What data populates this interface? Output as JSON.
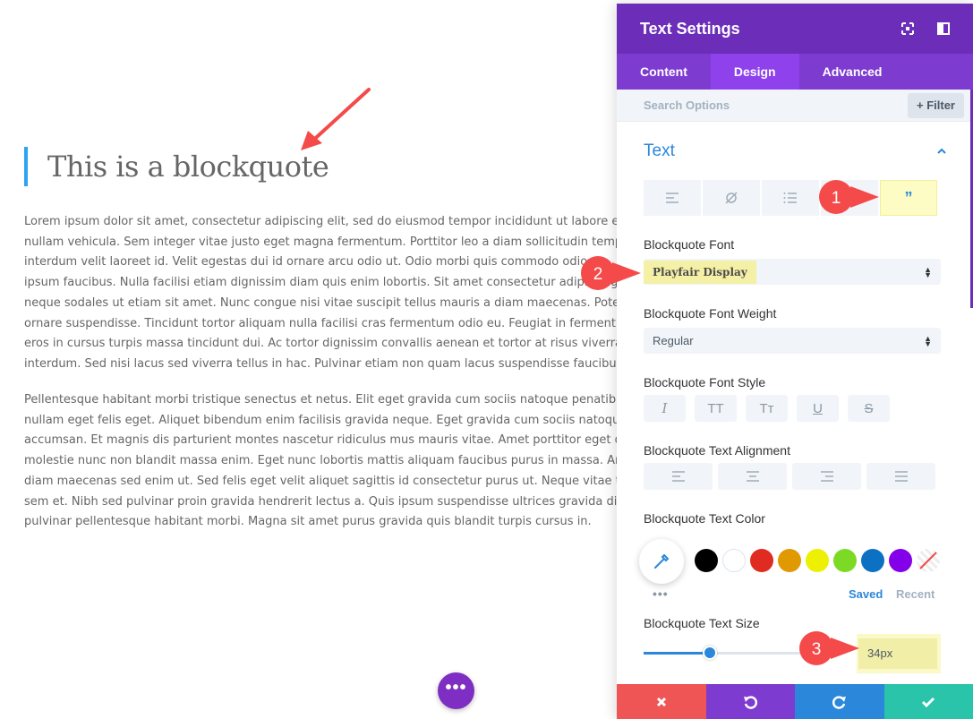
{
  "page": {
    "blockquote": "This is a blockquote",
    "paragraph1": [
      "Lorem ipsum dolor sit amet, consectetur adipiscing elit, sed do eiusmod tempor incididunt ut labore et",
      "nullam vehicula. Sem integer vitae justo eget magna fermentum. Porttitor leo a diam sollicitudin tempo",
      "interdum velit laoreet id. Velit egestas dui id ornare arcu odio ut. Odio morbi quis commodo odio",
      "ipsum faucibus. Nulla facilisi etiam dignissim diam quis enim lobortis. Sit amet consectetur adipiscing",
      "neque sodales ut etiam sit amet. Nunc congue nisi vitae suscipit tellus mauris a diam maecenas. Potenti",
      "ornare suspendisse. Tincidunt tortor aliquam nulla facilisi cras fermentum odio eu. Feugiat in fermentum",
      "eros in cursus turpis massa tincidunt dui. Ac tortor dignissim convallis aenean et tortor at risus viverra",
      "interdum. Sed nisi lacus sed viverra tellus in hac. Pulvinar etiam non quam lacus suspendisse faucibus"
    ],
    "paragraph2": [
      "Pellentesque habitant morbi tristique senectus et netus. Elit eget gravida cum sociis natoque penatibus",
      "nullam eget felis eget. Aliquet bibendum enim facilisis gravida neque. Eget gravida cum sociis natoque",
      "accumsan. Et magnis dis parturient montes nascetur ridiculus mus mauris vitae. Amet porttitor eget dolor",
      "molestie nunc non blandit massa enim. Eget nunc lobortis mattis aliquam faucibus purus in massa. Amet",
      "diam maecenas sed enim ut. Sed felis eget velit aliquet sagittis id consectetur purus ut. Neque vitae tempus",
      "sem et. Nibh sed pulvinar proin gravida hendrerit lectus a. Quis ipsum suspendisse ultrices gravida dictum",
      "pulvinar pellentesque habitant morbi. Magna sit amet purus gravida quis blandit turpis cursus in."
    ],
    "fab_icon": "more-dots-icon",
    "fab_label": "•••"
  },
  "panel": {
    "title": "Text Settings",
    "header_icons": [
      "fullscreen-icon",
      "split-view-icon"
    ],
    "tabs": [
      {
        "label": "Content"
      },
      {
        "label": "Design"
      },
      {
        "label": "Advanced"
      }
    ],
    "search_placeholder": "Search Options",
    "filter_label": "+ Filter",
    "section_title": "Text",
    "subtabs": [
      "align-left-icon",
      "link-off-icon",
      "list-icon",
      "ordered-list-icon",
      "quote-icon"
    ],
    "quote_glyph": "”",
    "font_label": "Blockquote Font",
    "font_value": "Playfair Display",
    "weight_label": "Blockquote Font Weight",
    "weight_value": "Regular",
    "style_label": "Blockquote Font Style",
    "style_buttons": [
      "I",
      "TT",
      "Tт",
      "U",
      "S"
    ],
    "alignment_label": "Blockquote Text Alignment",
    "color_label": "Blockquote Text Color",
    "swatch_colors": [
      "#000000",
      "#ffffff",
      "#e02b20",
      "#e09900",
      "#edf000",
      "#7cda24",
      "#0c71c3",
      "#8300e9"
    ],
    "saved_label": "Saved",
    "recent_label": "Recent",
    "size_label": "Blockquote Text Size",
    "size_value": "34px",
    "size_slider_fraction": 0.42,
    "footer_buttons": [
      "close-icon",
      "undo-icon",
      "redo-icon",
      "save-check-icon"
    ]
  },
  "badges": [
    "1",
    "2",
    "3"
  ],
  "colors": {
    "purple_header": "#6c2eb9",
    "accent_blue": "#2b87da",
    "highlight_yellow": "#f4f0a6",
    "badge_red": "#f44a4a"
  }
}
